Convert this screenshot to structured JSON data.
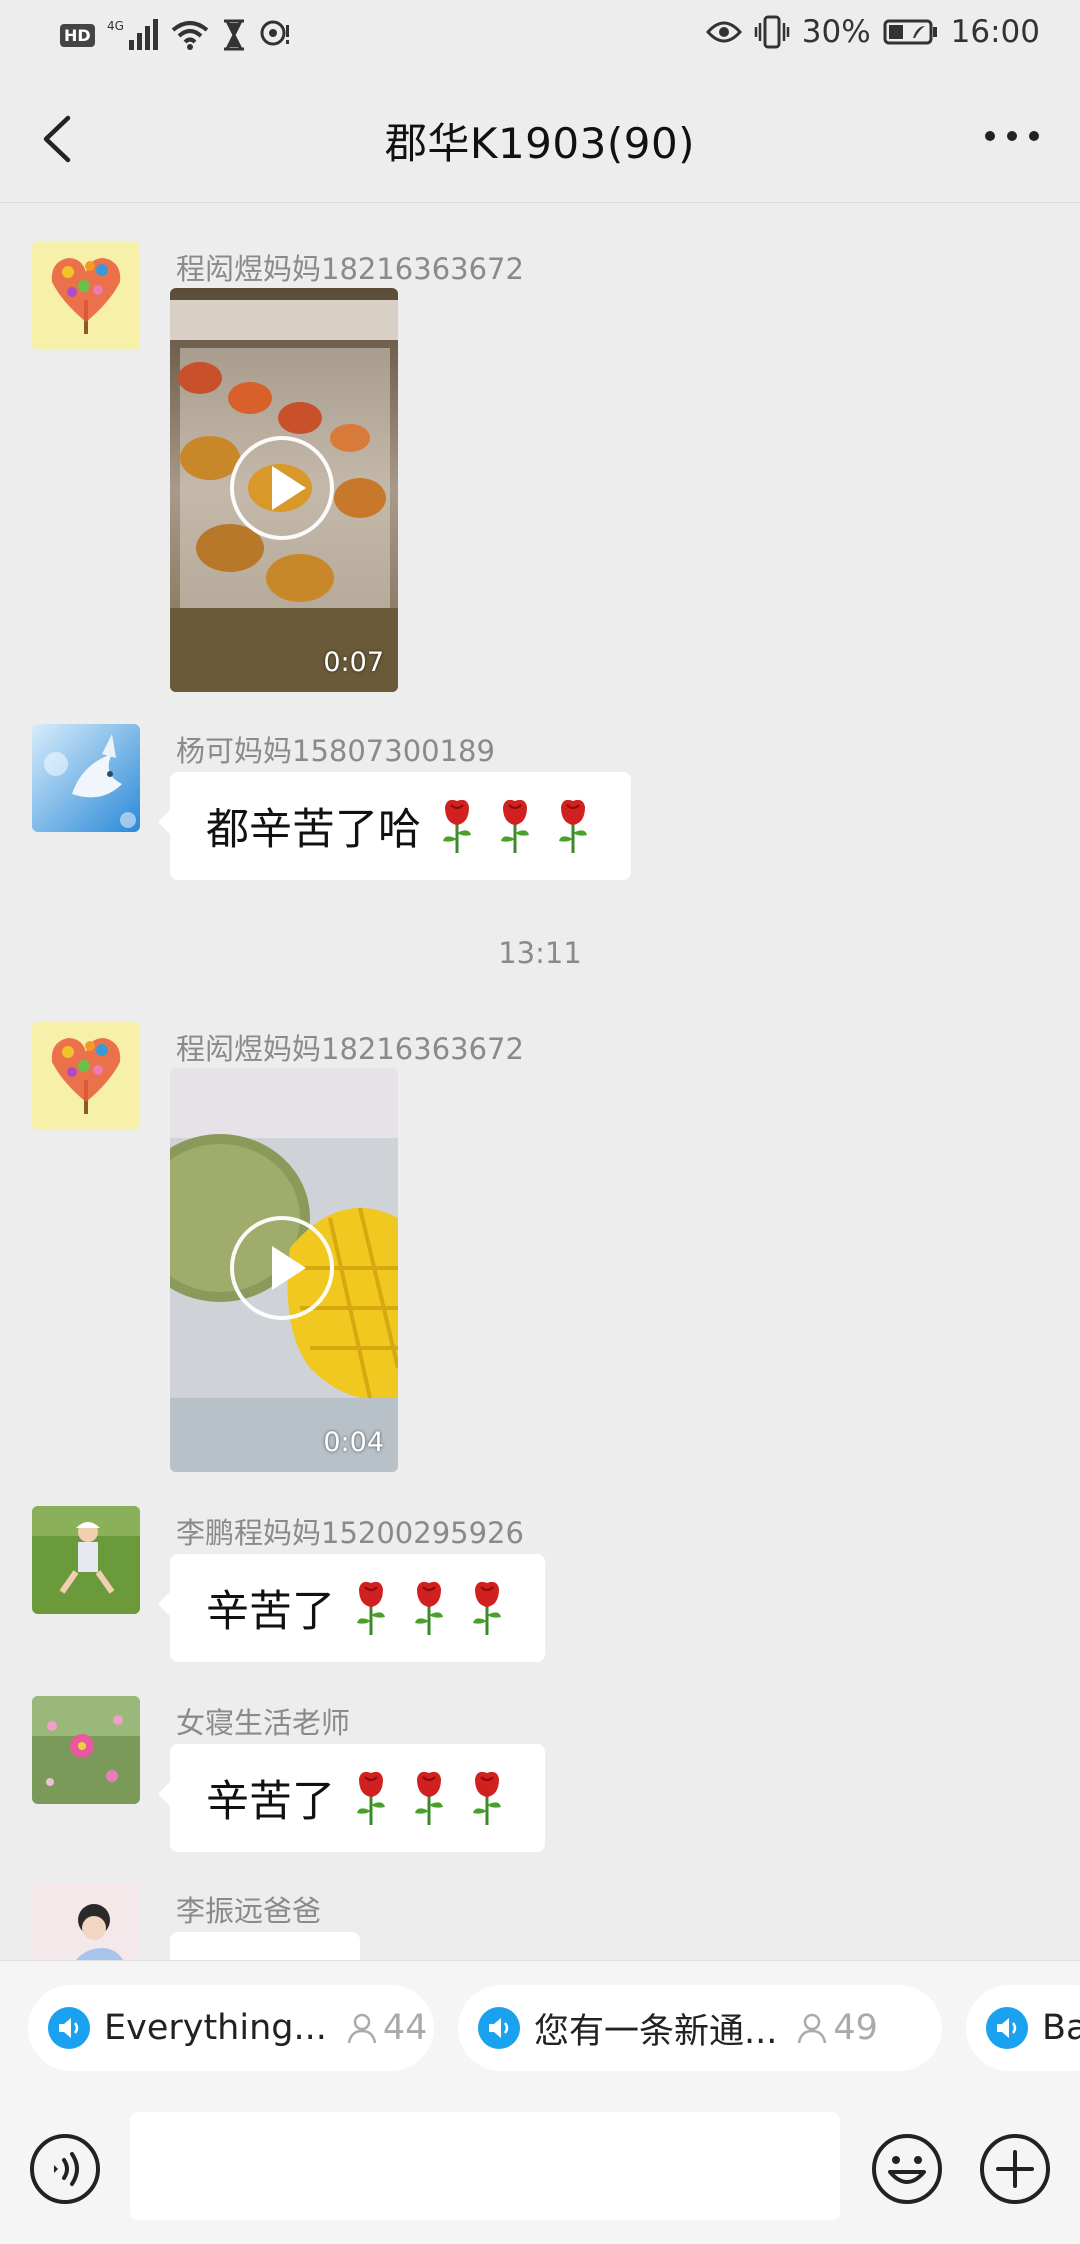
{
  "status_bar": {
    "hd": "HD",
    "network": "4G",
    "battery": "30%",
    "time": "16:00"
  },
  "header": {
    "title": "郡华K1903(90)"
  },
  "messages": [
    {
      "sender": "程闳煜妈妈18216363672",
      "type": "video",
      "duration": "0:07"
    },
    {
      "sender": "杨可妈妈15807300189",
      "type": "text",
      "text": "都辛苦了哈",
      "rose_count": 3
    },
    {
      "timestamp": "13:11"
    },
    {
      "sender": "程闳煜妈妈18216363672",
      "type": "video",
      "duration": "0:04"
    },
    {
      "sender": "李鹏程妈妈15200295926",
      "type": "text",
      "text": "辛苦了",
      "rose_count": 3
    },
    {
      "sender": "女寝生活老师",
      "type": "text",
      "text": "辛苦了",
      "rose_count": 3
    },
    {
      "sender": "李振远爸爸",
      "type": "text",
      "text": ""
    }
  ],
  "notices": [
    {
      "title": "Everything...",
      "count": "44"
    },
    {
      "title": "您有一条新通...",
      "count": "49"
    },
    {
      "title": "Ba",
      "count": ""
    }
  ],
  "colors": {
    "background": "#ededed",
    "bubble": "#ffffff",
    "accent": "#1aa1f0"
  }
}
